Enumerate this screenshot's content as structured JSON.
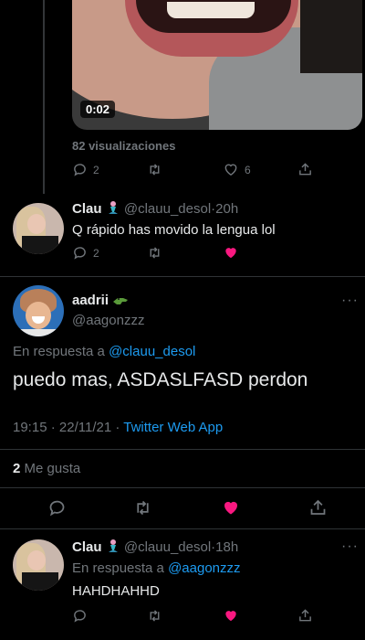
{
  "first_tweet": {
    "media_duration": "0:02",
    "views": "82 visualizaciones",
    "reply_count": "2",
    "like_count": "6"
  },
  "reply_1": {
    "name": "Clau",
    "handle": "@clauu_desol",
    "sep": "·",
    "time": "20h",
    "text": "Q rápido has movido la lengua lol",
    "reply_count": "2"
  },
  "main_tweet": {
    "name": "aadrii",
    "handle": "@aagonzzz",
    "replying_prefix": "En respuesta a",
    "replying_to": "@clauu_desol",
    "text": "puedo mas, ASDASLFASD perdon",
    "time": "19:15",
    "sep1": "·",
    "date": "22/11/21",
    "sep2": "·",
    "source": "Twitter Web App",
    "likes_count": "2",
    "likes_label": "Me gusta"
  },
  "reply_2": {
    "name": "Clau",
    "handle": "@clauu_desol",
    "sep": "·",
    "time": "18h",
    "replying_prefix": "En respuesta a",
    "replying_to": "@aagonzzz",
    "text": "HAHDHAHHD"
  },
  "more_symbol": "···",
  "colors": {
    "background": "#000000",
    "text": "#e7e9ea",
    "muted": "#71767b",
    "accent": "#1d9bf0",
    "like": "#f91880",
    "divider": "#2f3336"
  },
  "icons": [
    "reply-icon",
    "retweet-icon",
    "like-icon",
    "share-icon",
    "more-icon",
    "mermaid-emoji",
    "crocodile-emoji"
  ]
}
